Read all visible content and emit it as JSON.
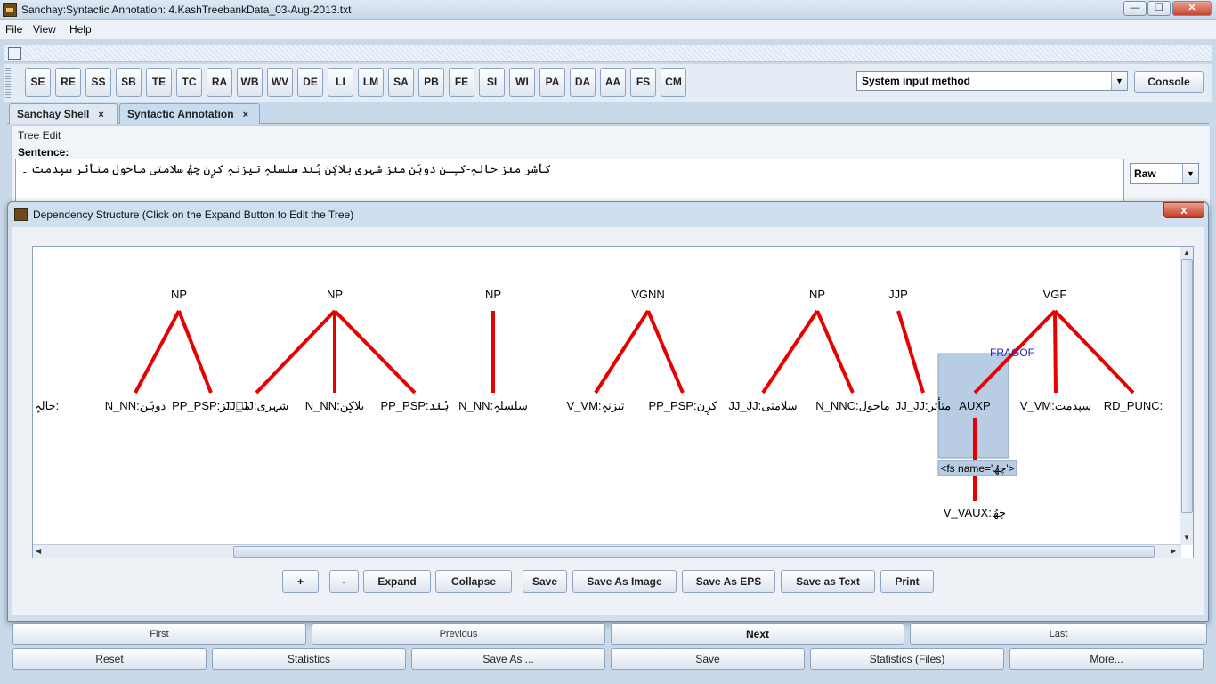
{
  "window": {
    "title": "Sanchay:Syntactic Annotation: 4.KashTreebankData_03-Aug-2013.txt"
  },
  "menu": [
    "File",
    "View",
    "Help"
  ],
  "toolbar": {
    "buttons": [
      "SE",
      "RE",
      "SS",
      "SB",
      "TE",
      "TC",
      "RA",
      "WB",
      "WV",
      "DE",
      "LI",
      "LM",
      "SA",
      "PB",
      "FE",
      "SI",
      "WI",
      "PA",
      "DA",
      "AA",
      "FS",
      "CM"
    ],
    "input_method": "System input method",
    "console_label": "Console"
  },
  "tabs": [
    {
      "label": "Sanchay Shell",
      "close": "×"
    },
    {
      "label": "Syntactic Annotation",
      "close": "×"
    }
  ],
  "tree_edit": {
    "group_title": "Tree Edit",
    "sentence_label": "Sentence:",
    "sentence": "کٲشِر منٛز حالہٕ-کـٕـن دوہَن منٛز شہری بلاکٕن ہُنٛد سلسلہٕ تیزنہٕ کرٕن چھُ سلامتی ماحول متأثر سپدمت ۔",
    "mode": "Raw"
  },
  "dialog": {
    "title": "Dependency Structure (Click on the Expand Button to Edit the Tree)",
    "close": "x",
    "tree": {
      "phrases": [
        {
          "label": "NP",
          "children": [
            "N_NN:دوہَن",
            "PP_PSP:منٛز"
          ]
        },
        {
          "label": "NP",
          "children": [
            "JJ_JJ:شہری",
            "N_NN:بلاکٕن",
            "PP_PSP:ہُنٛد"
          ]
        },
        {
          "label": "NP",
          "children": [
            "N_NN:سلسلہٕ"
          ]
        },
        {
          "label": "VGNN",
          "children": [
            "V_VM:تیزنہٕ",
            "PP_PSP:کرٕن"
          ]
        },
        {
          "label": "NP",
          "children": [
            "JJ_JJ:سلامتی",
            "N_NNC:ماحول"
          ]
        },
        {
          "label": "JJP",
          "children": [
            "JJ_JJ:متأثر"
          ]
        },
        {
          "label": "VGF",
          "children": [
            "AUXP",
            "V_VM:سپدمت",
            "RD_PUNC:"
          ]
        }
      ],
      "leading_word": "حالہٕ:",
      "relation_label": "FRAGOF",
      "expanded_node": {
        "label": "AUXP",
        "fs": "<fs name='چھُ'>",
        "child": "V_VAUX:چھُ"
      }
    },
    "buttons": [
      "+",
      "-",
      "Expand",
      "Collapse",
      "Save",
      "Save As Image",
      "Save As EPS",
      "Save as Text",
      "Print"
    ]
  },
  "nav": {
    "row1": [
      "First",
      "Previous",
      "Next",
      "Last"
    ],
    "row2": [
      "Reset",
      "Statistics",
      "Save As ...",
      "Save",
      "Statistics (Files)",
      "More..."
    ]
  }
}
